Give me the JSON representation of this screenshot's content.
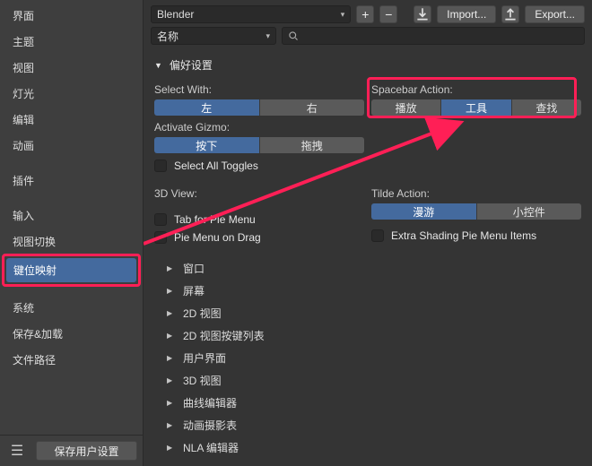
{
  "sidebar": {
    "groups": [
      [
        "界面",
        "主题",
        "视图",
        "灯光",
        "编辑",
        "动画"
      ],
      [
        "插件"
      ],
      [
        "输入",
        "视图切换",
        "键位映射"
      ],
      [
        "系统",
        "保存&加载",
        "文件路径"
      ]
    ],
    "selected": "键位映射",
    "highlighted": "键位映射",
    "footer": {
      "save": "保存用户设置"
    }
  },
  "top": {
    "preset": "Blender",
    "sort": "名称",
    "import": "Import...",
    "export": "Export..."
  },
  "sections": {
    "prefs_title": "偏好设置",
    "select_with": {
      "label": "Select With:",
      "options": [
        "左",
        "右"
      ],
      "active": "左"
    },
    "activate_gizmo": {
      "label": "Activate Gizmo:",
      "options": [
        "按下",
        "拖拽"
      ],
      "active": "按下"
    },
    "select_all_toggles": {
      "label": "Select All Toggles",
      "checked": false
    },
    "spacebar": {
      "label": "Spacebar Action:",
      "options": [
        "播放",
        "工具",
        "查找"
      ],
      "active": "工具"
    },
    "three_d": {
      "label": "3D View:",
      "tab_pie": {
        "label": "Tab for Pie Menu",
        "checked": false
      },
      "drag_pie": {
        "label": "Pie Menu on Drag",
        "checked": false
      }
    },
    "tilde": {
      "label": "Tilde Action:",
      "options": [
        "漫游",
        "小控件"
      ],
      "active": "漫游"
    },
    "extra_pie": {
      "label": "Extra Shading Pie Menu Items",
      "checked": false
    },
    "expanders": [
      "窗口",
      "屏幕",
      "2D 视图",
      "2D 视图按键列表",
      "用户界面",
      "3D 视图",
      "曲线编辑器",
      "动画摄影表",
      "NLA 编辑器"
    ]
  }
}
